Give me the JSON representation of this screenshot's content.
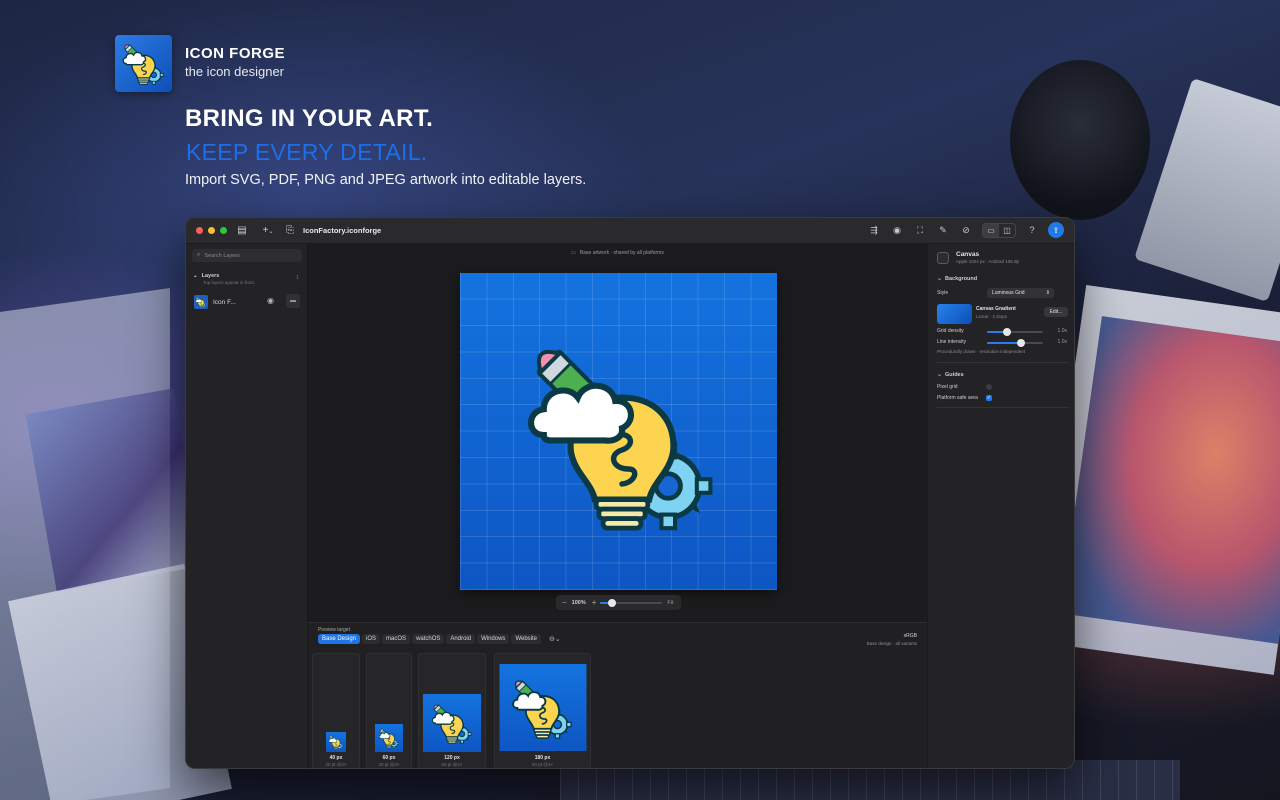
{
  "header": {
    "app_name": "ICON FORGE",
    "tagline": "the icon designer",
    "headline_1": "BRING IN YOUR ART.",
    "headline_2": "KEEP EVERY DETAIL.",
    "subheadline": "Import SVG, PDF, PNG and JPEG artwork into editable layers."
  },
  "window": {
    "document_title": "IconFactory.iconforge",
    "add_button_label": "+",
    "sidebar": {
      "search_placeholder": "Search Layers",
      "layers_heading": "Layers",
      "layers_hint": "Top layers appear in front.",
      "layer_count": "1",
      "layers": [
        {
          "name": "Icon F..."
        }
      ]
    },
    "canvas": {
      "hint": "Base artwork · shared by all platforms",
      "zoom_value": "100%",
      "zoom_fraction": 0.2,
      "fit_label": "Fit"
    },
    "preview": {
      "label": "Preview target",
      "tabs": [
        "Base Design",
        "iOS",
        "macOS",
        "watchOS",
        "Android",
        "Windows",
        "Website"
      ],
      "active_tab": "Base Design",
      "color_space": "sRGB",
      "color_space_note": "Base design · all variants",
      "sizes": [
        {
          "size": "40 px",
          "note": "20 pt @2×"
        },
        {
          "size": "60 px",
          "note": "20 pt @3×"
        },
        {
          "size": "120 px",
          "note": "60 pt @2×"
        },
        {
          "size": "180 px",
          "note": "60 pt @3×"
        }
      ]
    },
    "inspector": {
      "title": "Canvas",
      "subtitle": "Apple 1024 px · Android 108 dp",
      "background_section": "Background",
      "style_label": "Style",
      "style_value": "Luminous Grid",
      "gradient_name": "Canvas Gradient",
      "gradient_sub": "Linear · 2 stops",
      "edit_label": "Edit...",
      "grid_density_label": "Grid density",
      "grid_density_value": "1.0x",
      "grid_density_fraction": 0.35,
      "line_intensity_label": "Line intensity",
      "line_intensity_value": "1.0x",
      "line_intensity_fraction": 0.6,
      "note": "Procedurally drawn · resolution independent",
      "guides_section": "Guides",
      "pixel_grid_label": "Pixel grid",
      "pixel_grid_on": false,
      "safe_area_label": "Platform safe area",
      "safe_area_on": true
    }
  },
  "colors": {
    "accent": "#1e75e6",
    "headline_accent": "#1d6fe8",
    "artboard_top": "#1473df",
    "artboard_bottom": "#0d56c4"
  }
}
